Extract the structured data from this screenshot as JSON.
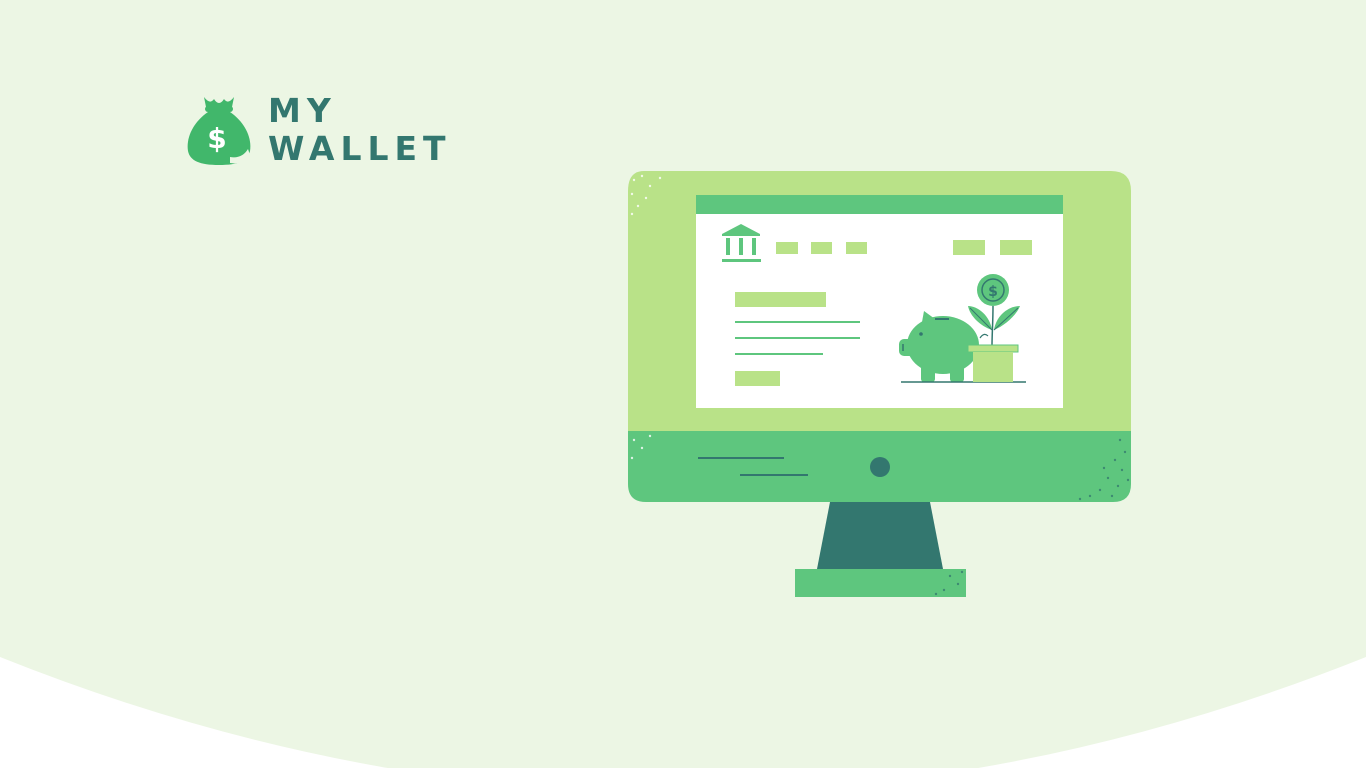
{
  "brand": {
    "line1": "MY",
    "line2": "WALLET",
    "icon": "money-bag-icon"
  },
  "illustration": {
    "subject": "desktop-monitor-with-bank-savings-screen",
    "icons": [
      "bank-icon",
      "piggy-bank-icon",
      "dollar-coin-plant-icon"
    ]
  },
  "colors": {
    "background": "#ecf6e4",
    "dark_teal": "#33776f",
    "green": "#5ec67e",
    "light_green": "#b9e288",
    "white": "#ffffff"
  }
}
